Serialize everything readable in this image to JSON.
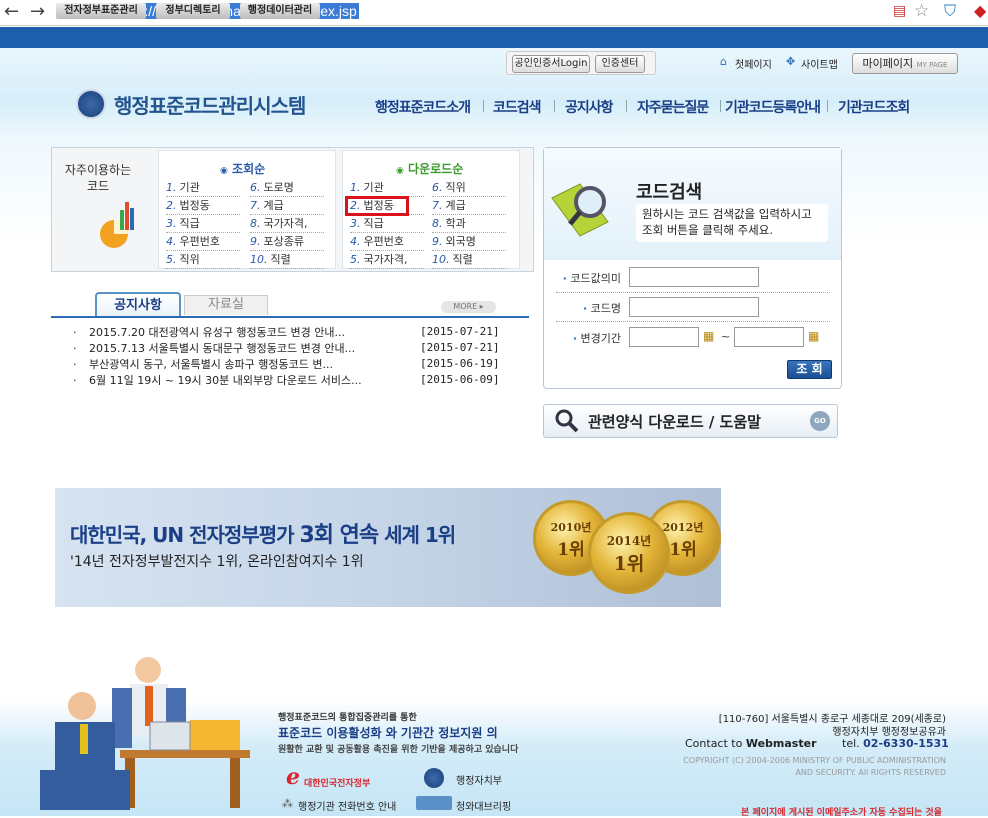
{
  "browser": {
    "url": "https://code.mogaha.go.kr/jsp/index.jsp",
    "back": "←",
    "forward": "→",
    "reload": "C"
  },
  "top_tabs": [
    "전자정부표준관리",
    "정부디렉토리",
    "행정데이터관리"
  ],
  "util": {
    "cert_login": "공인인증서Login",
    "cert_center": "인증센터",
    "first_page": "첫페이지",
    "sitemap": "사이트맵",
    "mypage": "마이페이지",
    "mypage_en": "MY PAGE"
  },
  "site_title": "행정표준코드관리시스템",
  "gnb": [
    "행정표준코드소개",
    "코드검색",
    "공지사항",
    "자주묻는질문",
    "기관코드등록안내",
    "기관코드조회"
  ],
  "frequent": {
    "label": "자주이용하는 코드",
    "view_title": "조회순",
    "download_title": "다운로드순",
    "view_items": [
      {
        "n": "1.",
        "t": "기관"
      },
      {
        "n": "2.",
        "t": "법정동"
      },
      {
        "n": "3.",
        "t": "직급"
      },
      {
        "n": "4.",
        "t": "우편번호"
      },
      {
        "n": "5.",
        "t": "직위"
      },
      {
        "n": "6.",
        "t": "도로명"
      },
      {
        "n": "7.",
        "t": "계급"
      },
      {
        "n": "8.",
        "t": "국가자격,"
      },
      {
        "n": "9.",
        "t": "포상종류"
      },
      {
        "n": "10.",
        "t": "직렬"
      }
    ],
    "download_items": [
      {
        "n": "1.",
        "t": "기관"
      },
      {
        "n": "2.",
        "t": "법정동"
      },
      {
        "n": "3.",
        "t": "직급"
      },
      {
        "n": "4.",
        "t": "우편번호"
      },
      {
        "n": "5.",
        "t": "국가자격,"
      },
      {
        "n": "6.",
        "t": "직위"
      },
      {
        "n": "7.",
        "t": "계급"
      },
      {
        "n": "8.",
        "t": "학과"
      },
      {
        "n": "9.",
        "t": "외국명"
      },
      {
        "n": "10.",
        "t": "직렬"
      }
    ]
  },
  "notice": {
    "tab_active": "공지사항",
    "tab_inactive": "자료실",
    "more": "MORE ▸",
    "rows": [
      {
        "title": "2015.7.20 대전광역시 유성구 행정동코드 변경 안내...",
        "date": "[2015-07-21]"
      },
      {
        "title": "2015.7.13 서울특별시 동대문구 행정동코드 변경 안내...",
        "date": "[2015-07-21]"
      },
      {
        "title": "부산광역시 동구, 서울특별시 송파구 행정동코드 변...",
        "date": "[2015-06-19]"
      },
      {
        "title": "6월 11일 19시 ~ 19시 30분 내외부망 다운로드 서비스...",
        "date": "[2015-06-09]"
      }
    ]
  },
  "search": {
    "title": "코드검색",
    "desc": "원하시는 코드 검색값을 입력하시고 조회 버튼을 클릭해 주세요.",
    "label_meaning": "코드값의미",
    "label_name": "코드명",
    "label_period": "변경기간",
    "tilde": "~",
    "button": "조 회"
  },
  "download_help": "관련양식 다운로드 / 도움말",
  "go": "GO",
  "banner": {
    "line1_a": "대한민국, UN 전자정부평가 ",
    "line1_b": "3회 연속",
    "line1_c": " 세계 1위",
    "line2": "'14년 전자정부발전지수 1위, 온라인참여지수 1위",
    "medals": [
      {
        "year": "2010년",
        "rank": "1위"
      },
      {
        "year": "2014년",
        "rank": "1위"
      },
      {
        "year": "2012년",
        "rank": "1위"
      }
    ]
  },
  "footer": {
    "tag1": "행정표준코드의 통합집중관리를 통한",
    "tag2": "표준코드 이용활성화 와 기관간 정보지원 의",
    "tag3": "원활한 교환 및 공동활용 촉진을 위한 기반을 제공하고 있습니다",
    "logo1": "대한민국전자정부",
    "logo2": "행정자치부",
    "link1": "행정기관 전화번호 안내",
    "link2": "청와대브리핑",
    "address": "[110-760] 서울특별시 종로구 세종대로 209(세종로)",
    "org": "행정자치부 행정정보공유과",
    "contact": "Contact to",
    "webmaster": "Webmaster",
    "tel": "tel.",
    "tel_num": "02-6330-1531",
    "copyright1": "COPYRIGHT (C) 2004-2006 MINISTRY OF PUBLIC ADMINISTRATION",
    "copyright2": "AND SECURITY. All RIGHTS RESERVED",
    "notice_email": "본 페이지에 게시된 이메일주소가 자동 수집되는 것을"
  }
}
